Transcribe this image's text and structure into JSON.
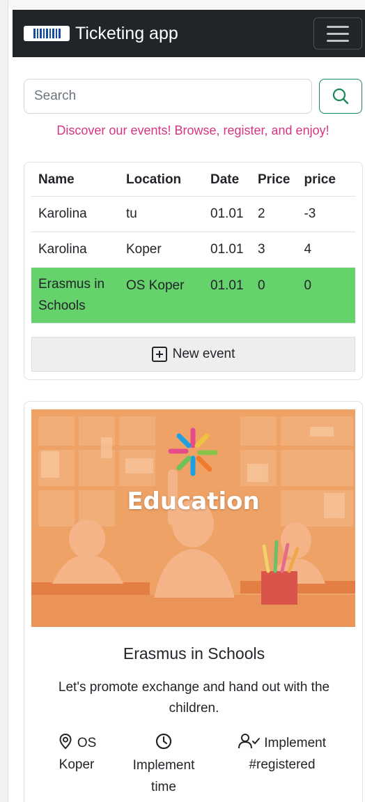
{
  "app": {
    "title": "Ticketing app"
  },
  "search": {
    "placeholder": "Search",
    "value": ""
  },
  "tagline": "Discover our events! Browse, register, and enjoy!",
  "events_table": {
    "columns": [
      "Name",
      "Location",
      "Date",
      "Price",
      "price"
    ],
    "rows": [
      {
        "name": "Karolina",
        "location": "tu",
        "date": "01.01",
        "price": "2",
        "price2": "-3"
      },
      {
        "name": "Karolina",
        "location": "Koper",
        "date": "01.01",
        "price": "3",
        "price2": "4"
      },
      {
        "name": "Erasmus in Schools",
        "location": "OS Koper",
        "date": "01.01",
        "price": "0",
        "price2": "0"
      }
    ],
    "new_event_label": "New event"
  },
  "event_card": {
    "image_caption": "Education",
    "title": "Erasmus in Schools",
    "description": "Let's promote exchange and hand out with the children.",
    "location": "OS Koper",
    "time": "Implement time",
    "registered": "Implement #registered"
  },
  "colors": {
    "navbar": "#212529",
    "accent_green": "#198754",
    "highlight_row": "#66d26c",
    "tagline": "#d63384",
    "image_overlay": "#efa266"
  },
  "icons": [
    "ticket-logo-icon",
    "hamburger-icon",
    "search-icon",
    "plus-square-icon",
    "geo-pin-icon",
    "clock-icon",
    "person-check-icon"
  ]
}
